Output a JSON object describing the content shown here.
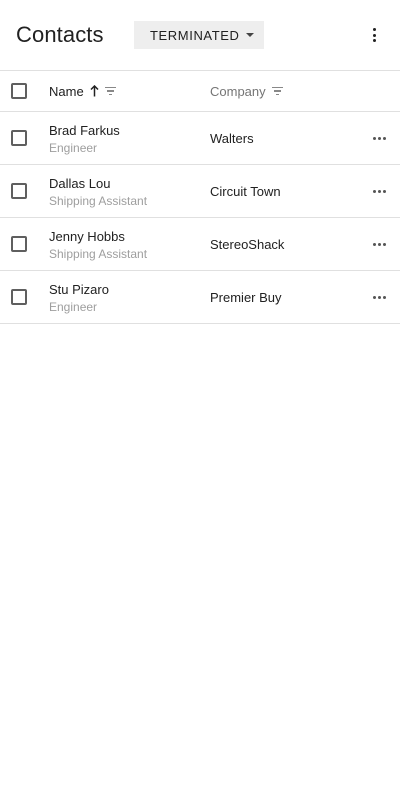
{
  "header": {
    "title": "Contacts",
    "filter_selected": "TERMINATED",
    "more_icon": "more-vert-icon"
  },
  "table": {
    "columns": [
      {
        "label": "Name",
        "sort": "ascending",
        "filterable": true
      },
      {
        "label": "Company",
        "filterable": true
      }
    ],
    "rows": [
      {
        "name": "Brad Farkus",
        "title": "Engineer",
        "company": "Walters"
      },
      {
        "name": "Dallas Lou",
        "title": "Shipping Assistant",
        "company": "Circuit Town"
      },
      {
        "name": "Jenny Hobbs",
        "title": "Shipping Assistant",
        "company": "StereoShack"
      },
      {
        "name": "Stu Pizaro",
        "title": "Engineer",
        "company": "Premier Buy"
      }
    ]
  },
  "colors": {
    "text_primary": "#212121",
    "text_secondary": "#9e9e9e",
    "divider": "#e0e0e0",
    "select_bg": "#eeeeee"
  }
}
